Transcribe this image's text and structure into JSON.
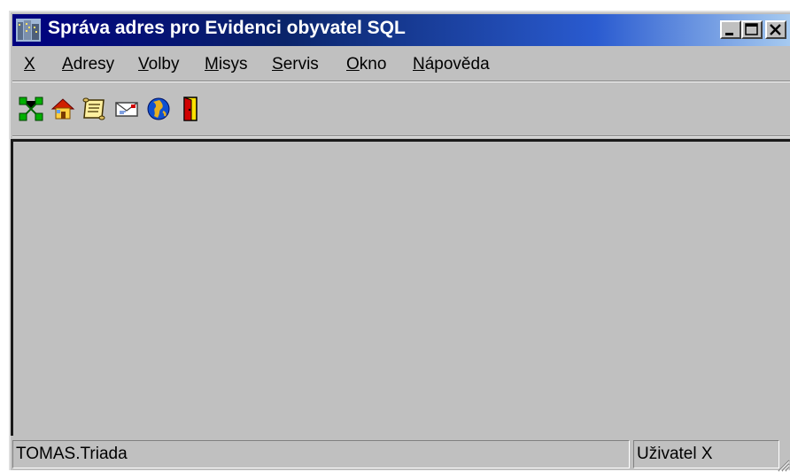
{
  "window": {
    "title": "Správa adres pro Evidenci obyvatel SQL",
    "caption_buttons": [
      "minimize-icon",
      "maximize-icon",
      "close-icon"
    ],
    "title_gradient": [
      "#000080",
      "#a6caf0"
    ]
  },
  "menu": {
    "items": [
      {
        "key": "X",
        "rest": ""
      },
      {
        "key": "A",
        "rest": "dresy"
      },
      {
        "key": "V",
        "rest": "olby"
      },
      {
        "key": "M",
        "rest": "isys"
      },
      {
        "key": "S",
        "rest": "ervis"
      },
      {
        "key": "O",
        "rest": "kno"
      },
      {
        "key": "N",
        "rest": "ápověda"
      }
    ]
  },
  "toolbar": {
    "buttons": [
      "network-icon",
      "home-icon",
      "scroll-icon",
      "envelope-icon",
      "globe-icon",
      "exit-door-icon"
    ]
  },
  "status": {
    "left": "TOMAS.Triada",
    "right": "Uživatel X"
  }
}
